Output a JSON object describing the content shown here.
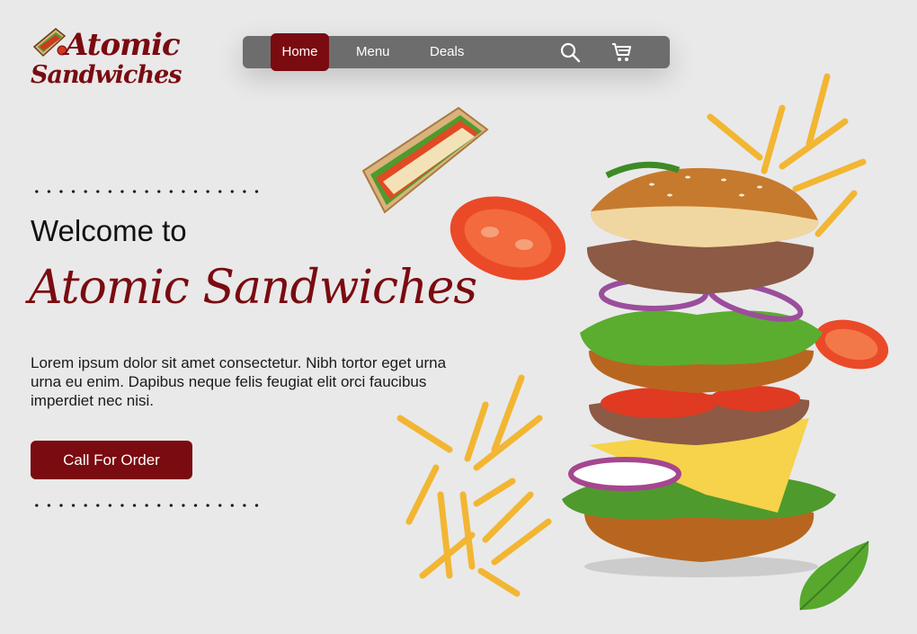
{
  "brand": {
    "logo_line1": "Atomic",
    "logo_line2": "Sandwiches",
    "logo_icon": "sandwich-icon"
  },
  "nav": {
    "items": [
      {
        "label": "Home",
        "active": true
      },
      {
        "label": "Menu",
        "active": false
      },
      {
        "label": "Deals",
        "active": false
      }
    ],
    "icons": [
      "search-icon",
      "cart-icon"
    ]
  },
  "hero": {
    "welcome": "Welcome to",
    "title": "Atomic Sandwiches",
    "description": "Lorem ipsum dolor sit amet consectetur. Nibh tortor eget urna urna eu enim. Dapibus neque felis feugiat elit orci faucibus imperdiet nec nisi.",
    "cta_label": "Call For Order"
  },
  "colors": {
    "accent": "#7a0b10",
    "nav_bg": "#6d6d6e",
    "page_bg": "#e9e9ea",
    "text": "#111111"
  }
}
